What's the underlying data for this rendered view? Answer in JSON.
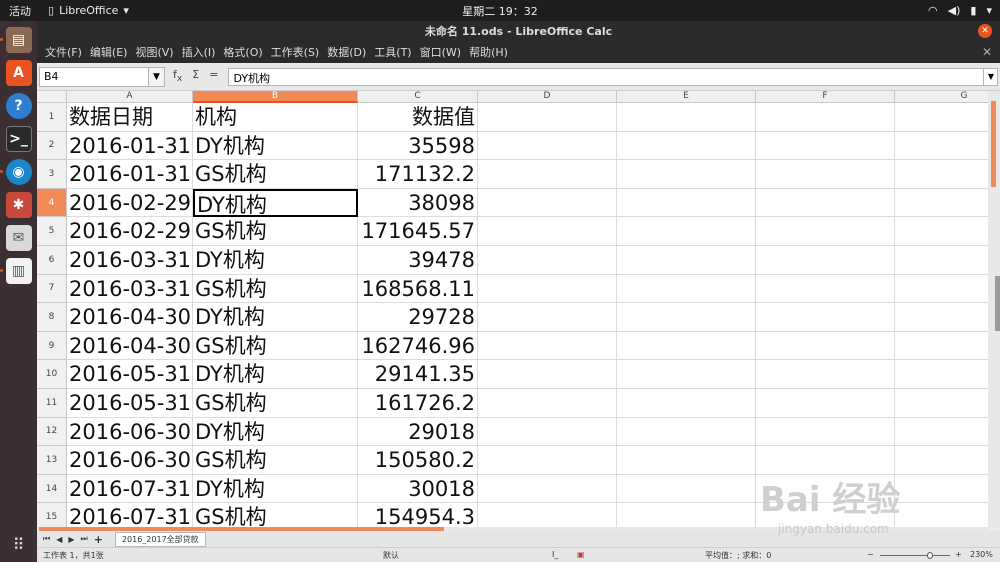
{
  "topbar": {
    "activities": "活动",
    "app_name": "LibreOffice",
    "clock": "星期二 19：32"
  },
  "window": {
    "title": "未命名 11.ods - LibreOffice Calc"
  },
  "menu": [
    "文件(F)",
    "编辑(E)",
    "视图(V)",
    "插入(I)",
    "格式(O)",
    "工作表(S)",
    "数据(D)",
    "工具(T)",
    "窗口(W)",
    "帮助(H)"
  ],
  "formula_bar": {
    "name_box": "B4",
    "content": "DY机构"
  },
  "columns": [
    "A",
    "B",
    "C",
    "D",
    "E",
    "F",
    "G"
  ],
  "active_column": "B",
  "active_row": 4,
  "rows": [
    {
      "n": "1",
      "a": "数据日期",
      "b": "机构",
      "c": "数据值"
    },
    {
      "n": "2",
      "a": "2016-01-31",
      "b": "DY机构",
      "c": "35598"
    },
    {
      "n": "3",
      "a": "2016-01-31",
      "b": "GS机构",
      "c": "171132.2"
    },
    {
      "n": "4",
      "a": "2016-02-29",
      "b": "DY机构",
      "c": "38098"
    },
    {
      "n": "5",
      "a": "2016-02-29",
      "b": "GS机构",
      "c": "171645.57"
    },
    {
      "n": "6",
      "a": "2016-03-31",
      "b": "DY机构",
      "c": "39478"
    },
    {
      "n": "7",
      "a": "2016-03-31",
      "b": "GS机构",
      "c": "168568.11"
    },
    {
      "n": "8",
      "a": "2016-04-30",
      "b": "DY机构",
      "c": "29728"
    },
    {
      "n": "9",
      "a": "2016-04-30",
      "b": "GS机构",
      "c": "162746.96"
    },
    {
      "n": "10",
      "a": "2016-05-31",
      "b": "DY机构",
      "c": "29141.35"
    },
    {
      "n": "11",
      "a": "2016-05-31",
      "b": "GS机构",
      "c": "161726.2"
    },
    {
      "n": "12",
      "a": "2016-06-30",
      "b": "DY机构",
      "c": "29018"
    },
    {
      "n": "13",
      "a": "2016-06-30",
      "b": "GS机构",
      "c": "150580.2"
    },
    {
      "n": "14",
      "a": "2016-07-31",
      "b": "DY机构",
      "c": "30018"
    },
    {
      "n": "15",
      "a": "2016-07-31",
      "b": "GS机构",
      "c": "154954.3"
    }
  ],
  "sheet_tab": "2016_2017全部贷款",
  "statusbar": {
    "sheet_info": "工作表 1，共1张",
    "style": "默认",
    "summary": "平均值：; 求和：0",
    "zoom": "230%"
  },
  "watermark": {
    "brand": "Bai 经验",
    "url": "jingyan.baidu.com"
  },
  "colors": {
    "accent": "#e95420",
    "header_active": "#f28a55"
  }
}
